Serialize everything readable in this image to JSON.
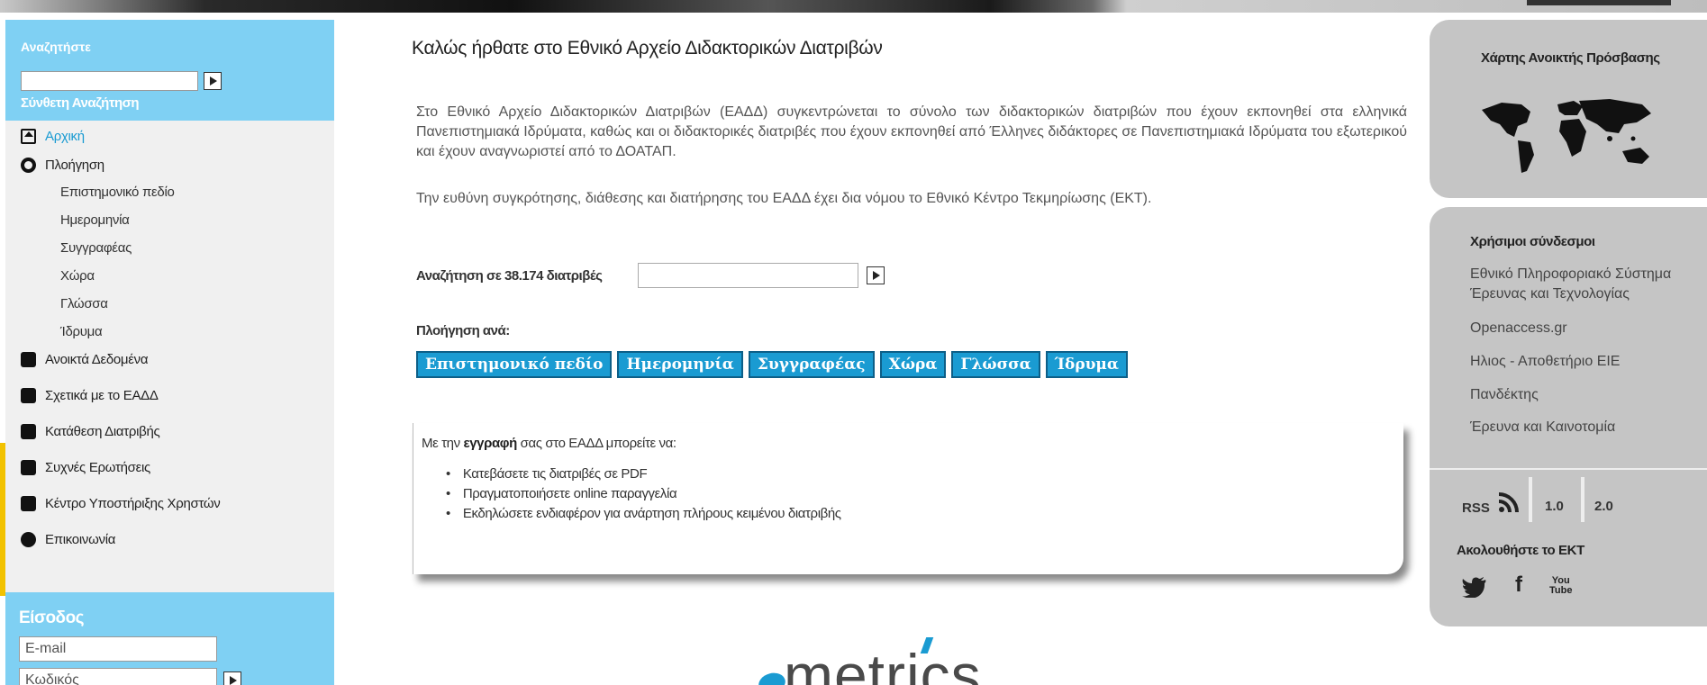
{
  "left_sidebar": {
    "search_title": "Αναζητήστε",
    "advanced_search": "Σύνθετη Αναζήτηση",
    "menu": {
      "home": "Αρχική",
      "browse": "Πλοήγηση",
      "browse_sub": [
        "Επιστημονικό πεδίο",
        "Ημερομηνία",
        "Συγγραφέας",
        "Χώρα",
        "Γλώσσα",
        "Ίδρυμα"
      ],
      "open_data": "Ανοικτά Δεδομένα",
      "about": "Σχετικά με το ΕΑΔΔ",
      "submit": "Κατάθεση Διατριβής",
      "faq": "Συχνές Ερωτήσεις",
      "support": "Κέντρο Υποστήριξης Χρηστών",
      "contact": "Επικοινωνία"
    },
    "login": {
      "title": "Είσοδος",
      "email_placeholder": "E-mail",
      "password_placeholder": "Κωδικός"
    }
  },
  "main": {
    "title": "Καλώς ήρθατε στο Εθνικό Αρχείο Διδακτορικών Διατριβών",
    "intro": "Στο Εθνικό Αρχείο Διδακτορικών Διατριβών (ΕΑΔΔ) συγκεντρώνεται το σύνολο των διδακτορικών διατριβών που έχουν εκπονηθεί στα ελληνικά Πανεπιστημιακά Ιδρύματα, καθώς και οι διδακτορικές διατριβές που έχουν εκπονηθεί από Έλληνες διδάκτορες σε Πανεπιστημιακά Ιδρύματα του εξωτερικού και έχουν αναγνωριστεί από το ΔΟΑΤΑΠ.",
    "intro2": "Την ευθύνη συγκρότησης, διάθεσης και διατήρησης του ΕΑΔΔ έχει δια νόμου το Εθνικό Κέντρο Τεκμηρίωσης (ΕΚΤ).",
    "search_label": "Αναζήτηση σε 38.174 διατριβές",
    "browse_label": "Πλοήγηση ανά:",
    "browse_buttons": [
      "Επιστημονικό πεδίο",
      "Ημερομηνία",
      "Συγγραφέας",
      "Χώρα",
      "Γλώσσα",
      "Ίδρυμα"
    ],
    "register": {
      "prefix": "Με την ",
      "bold": "εγγραφή",
      "suffix": " σας στο ΕΑΔΔ μπορείτε να:",
      "items": [
        "Κατεβάσετε τις διατριβές σε PDF",
        "Πραγματοποιήσετε online παραγγελία",
        "Εκδηλώσετε ενδιαφέρον για ανάρτηση πλήρους κειμένου διατριβής"
      ]
    },
    "logo_text": "metrics"
  },
  "right_sidebar": {
    "map_title": "Χάρτης Ανοικτής Πρόσβασης",
    "links_title": "Χρήσιμοι σύνδεσμοι",
    "links": [
      "Εθνικό Πληροφοριακό Σύστημα Έρευνας και Τεχνολογίας",
      "Openaccess.gr",
      "Ηλιος - Αποθετήριο ΕΙΕ",
      "Πανδέκτης",
      "Έρευνα και Καινοτομία"
    ],
    "rss_label": "RSS",
    "rss_v1": "1.0",
    "rss_v2": "2.0",
    "follow_label": "Ακολουθήστε το ΕΚΤ",
    "social": {
      "twitter_icon": "twitter-icon",
      "facebook_icon": "facebook-icon",
      "youtube_icon": "youtube-icon"
    },
    "youtube_text_1": "You",
    "youtube_text_2": "Tube"
  },
  "colors": {
    "accent_blue": "#1a9bd2",
    "panel_blue": "#7fd0f3",
    "panel_gray": "#c5c5c5"
  }
}
